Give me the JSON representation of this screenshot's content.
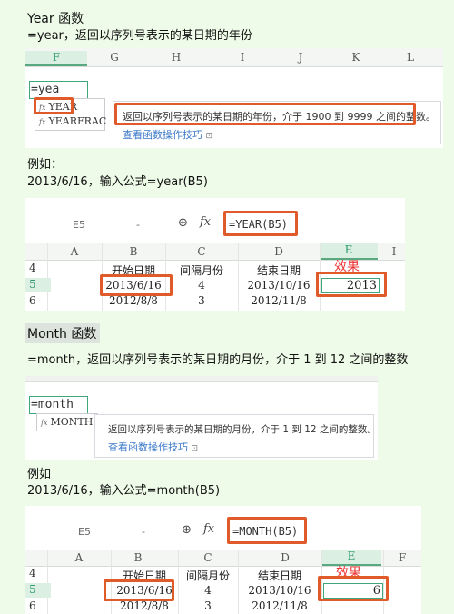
{
  "year_section": {
    "heading": "Year 函数",
    "description": "=year，返回以序列号表示的某日期的年份",
    "sheet1": {
      "columns": [
        "F",
        "G",
        "H",
        "I",
        "J",
        "K",
        "L"
      ],
      "input_value": "=yea",
      "suggestions": [
        "YEAR",
        "YEARFRAC"
      ],
      "tooltip_text": "返回以序列号表示的某日期的年份，介于 1900 到 9999 之间的整数。",
      "tooltip_link": "查看函数操作技巧"
    },
    "example_label": "例如：",
    "example_formula": "2013/6/16，输入公式=year(B5)",
    "sheet2": {
      "cell_ref": "E5",
      "dash": "-",
      "formula": "=YEAR(B5)",
      "columns": [
        "A",
        "B",
        "C",
        "D",
        "E",
        "I"
      ],
      "result_label": "效果",
      "rows": [
        {
          "num": "4",
          "cells": [
            "",
            "开始日期",
            "间隔月份",
            "结束日期",
            ""
          ]
        },
        {
          "num": "5",
          "cells": [
            "",
            "2013/6/16",
            "4",
            "2013/10/16",
            "2013"
          ]
        },
        {
          "num": "6",
          "cells": [
            "",
            "2012/8/8",
            "3",
            "2012/11/8",
            ""
          ]
        }
      ]
    }
  },
  "month_section": {
    "heading": "Month 函数",
    "description": "=month，返回以序列号表示的某日期的月份，介于 1 到 12 之间的整数",
    "sheet1": {
      "input_value": "=month",
      "suggestions": [
        "MONTH"
      ],
      "tooltip_text": "返回以序列号表示的某日期的月份，介于 1 到 12 之间的整数。",
      "tooltip_link": "查看函数操作技巧"
    },
    "example_label": "例如",
    "example_formula": "2013/6/16，输入公式=month(B5)",
    "sheet2": {
      "cell_ref": "E5",
      "dash": "-",
      "formula": "=MONTH(B5)",
      "columns": [
        "A",
        "B",
        "C",
        "D",
        "E",
        "F"
      ],
      "result_label": "效果",
      "rows": [
        {
          "num": "4",
          "cells": [
            "",
            "开始日期",
            "间隔月份",
            "结束日期",
            ""
          ]
        },
        {
          "num": "5",
          "cells": [
            "",
            "2013/6/16",
            "4",
            "2013/10/16",
            "6"
          ]
        },
        {
          "num": "6",
          "cells": [
            "",
            "2012/8/8",
            "3",
            "2012/11/8",
            ""
          ]
        }
      ]
    }
  },
  "icons": {
    "zoom": "magnifier-icon",
    "fx": "fx-icon",
    "doc": "doc-icon",
    "func": "function-icon"
  },
  "colors": {
    "highlight": "#e05a2a",
    "selected": "#2f9a6e",
    "link": "#3b78c8",
    "background": "#eefbe8"
  }
}
